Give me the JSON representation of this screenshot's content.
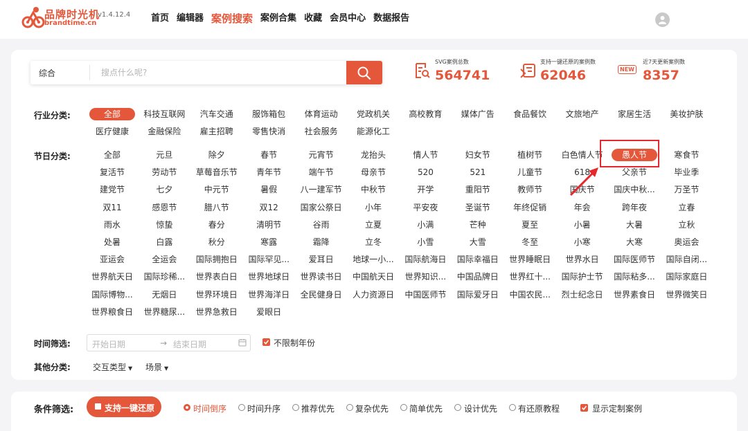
{
  "header": {
    "brand_cn": "品牌时光机",
    "brand_en": "brandtime.cn",
    "version": "v1.4.12.4",
    "nav": [
      "首页",
      "编辑器",
      "案例搜索",
      "案例合集",
      "收藏",
      "会员中心",
      "数据报告"
    ],
    "nav_active": "案例搜索"
  },
  "search": {
    "type_label": "综合",
    "placeholder": "搜点什么呢?"
  },
  "stats": [
    {
      "label": "SVG案例总数",
      "value": "564741"
    },
    {
      "label": "支持一键还原的案例数",
      "value": "62046"
    },
    {
      "label": "近7天更新案例数",
      "value": "8357",
      "badge": "NEW"
    }
  ],
  "industry": {
    "label": "行业分类:",
    "items": [
      "全部",
      "科技互联网",
      "汽车交通",
      "服饰箱包",
      "体育运动",
      "党政机关",
      "高校教育",
      "媒体广告",
      "食品餐饮",
      "文旅地产",
      "家居生活",
      "美妆护肤",
      "医疗健康",
      "金融保险",
      "雇主招聘",
      "零售快消",
      "社会服务",
      "能源化工"
    ],
    "active_index": 0
  },
  "festival": {
    "label": "节日分类:",
    "items": [
      "全部",
      "元旦",
      "除夕",
      "春节",
      "元宵节",
      "龙抬头",
      "情人节",
      "妇女节",
      "植树节",
      "白色情人节",
      "愚人节",
      "寒食节",
      "复活节",
      "劳动节",
      "草莓音乐节",
      "青年节",
      "端午节",
      "母亲节",
      "520",
      "521",
      "儿童节",
      "618",
      "父亲节",
      "毕业季",
      "建党节",
      "七夕",
      "中元节",
      "暑假",
      "八一建军节",
      "中秋节",
      "开学",
      "重阳节",
      "教师节",
      "国庆节",
      "国庆中秋...",
      "万圣节",
      "双11",
      "感恩节",
      "腊八节",
      "双12",
      "国家公祭日",
      "小年",
      "平安夜",
      "圣诞节",
      "年终促销",
      "年会",
      "跨年夜",
      "立春",
      "雨水",
      "惊蛰",
      "春分",
      "清明节",
      "谷雨",
      "立夏",
      "小满",
      "芒种",
      "夏至",
      "小暑",
      "大暑",
      "立秋",
      "处暑",
      "白露",
      "秋分",
      "寒露",
      "霜降",
      "立冬",
      "小雪",
      "大雪",
      "冬至",
      "小寒",
      "大寒",
      "奥运会",
      "亚运会",
      "全运会",
      "国际拥抱日",
      "国际罕见...",
      "爱耳日",
      "地球一小...",
      "国际航海日",
      "国际幸福日",
      "世界睡眠日",
      "世界水日",
      "国际医师节",
      "国际自闭...",
      "世界航天日",
      "国际珍稀...",
      "世界表白日",
      "世界地球日",
      "世界读书日",
      "中国航天日",
      "世界知识...",
      "中国品牌日",
      "世界红十...",
      "国际护士节",
      "国际粘多...",
      "国际家庭日",
      "国际博物...",
      "无烟日",
      "世界环境日",
      "世界海洋日",
      "全民健身日",
      "人力资源日",
      "中国医师节",
      "国际爱牙日",
      "中国农民...",
      "烈士纪念日",
      "世界素食日",
      "世界微笑日",
      "世界粮食日",
      "世界糖尿...",
      "世界急救日",
      "爱眼日"
    ],
    "active_index": 10
  },
  "time_filter": {
    "label": "时间筛选:",
    "start_placeholder": "开始日期",
    "arrow": "→",
    "end_placeholder": "结束日期",
    "unlimited_label": "不限制年份",
    "unlimited_checked": true
  },
  "other": {
    "label": "其他分类:",
    "items": [
      "交互类型",
      "场景"
    ]
  },
  "conditions": {
    "label": "条件筛选:",
    "support_button": "支持一键还原",
    "sort_options": [
      "时间倒序",
      "时间升序",
      "推荐优先",
      "复杂优先",
      "简单优先",
      "设计优先",
      "有还原教程"
    ],
    "sort_selected": 0,
    "show_custom_label": "显示定制案例",
    "show_custom_checked": true
  },
  "colors": {
    "accent": "#e5573a",
    "highlight_border": "#e5272e"
  }
}
